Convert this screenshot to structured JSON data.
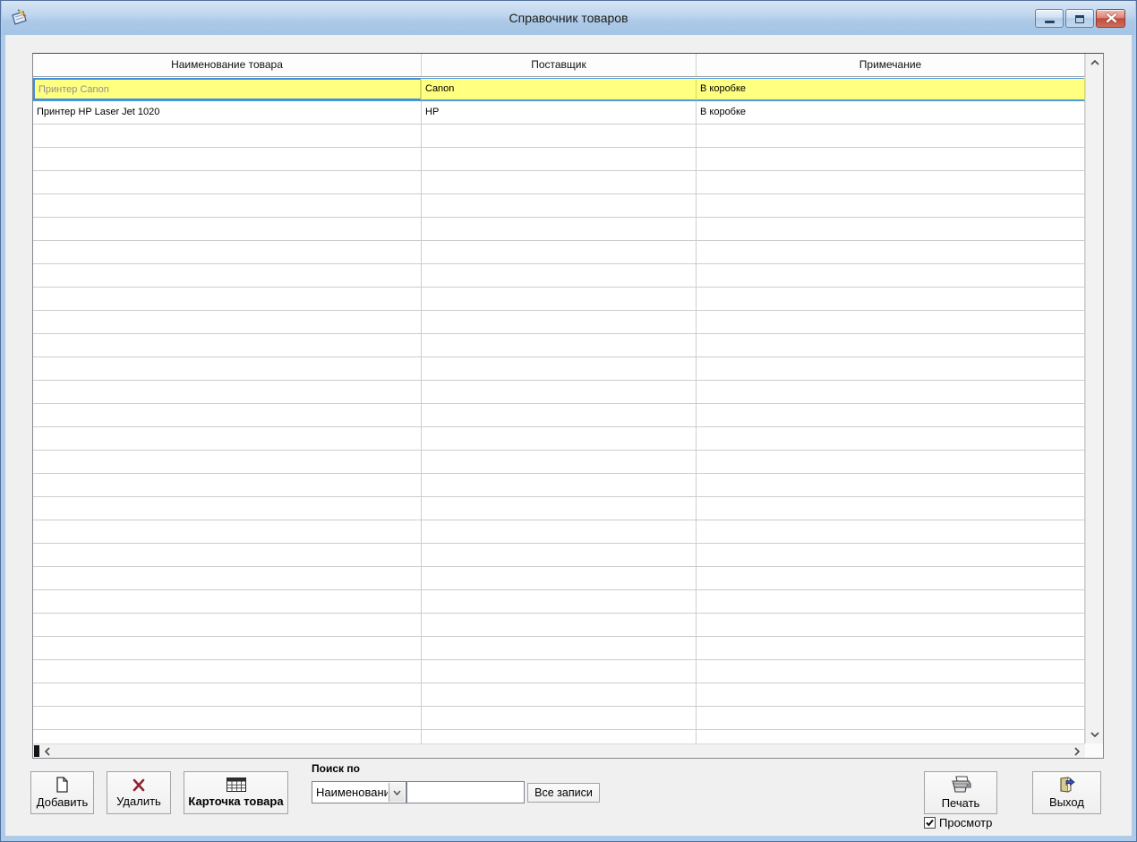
{
  "window": {
    "title": "Справочник товаров",
    "controls": [
      {
        "name": "minimize",
        "icon": "minimize-icon"
      },
      {
        "name": "maximize",
        "icon": "maximize-icon"
      },
      {
        "name": "close",
        "icon": "close-icon"
      }
    ],
    "app_icon": "notepad-pencil-icon"
  },
  "grid": {
    "columns": [
      {
        "label": "Наименование товара"
      },
      {
        "label": "Поставщик"
      },
      {
        "label": "Примечание"
      }
    ],
    "rows": [
      {
        "cells": [
          "Принтер Canon",
          "Canon",
          "В коробке"
        ],
        "selected": true
      },
      {
        "cells": [
          "Принтер HP Laser Jet 1020",
          "HP",
          "В коробке"
        ],
        "selected": false
      }
    ]
  },
  "actions": {
    "add": "Добавить",
    "delete": "Удалить",
    "card": "Карточка товара",
    "all_records": "Все записи",
    "print": "Печать",
    "preview": "Просмотр",
    "preview_checked": true,
    "exit": "Выход"
  },
  "search": {
    "label": "Поиск по",
    "field_selected": "Наименованию",
    "query": ""
  },
  "icons": {
    "add": "blank-document-icon",
    "delete": "red-cross-icon",
    "card": "spreadsheet-icon",
    "print": "printer-icon",
    "exit": "door-exit-icon",
    "combo_arrow": "chevron-down-icon",
    "preview": "checkmark-icon",
    "scrollbar": [
      "chevron-up-icon",
      "chevron-down-icon",
      "chevron-left-icon",
      "chevron-right-icon"
    ]
  },
  "colors": {
    "selection_yellow": "#FFFF80",
    "focus_blue": "#3E8FE0",
    "titlebar_blue": "#B9D2EC",
    "close_red": "#C14B3B",
    "client_gray": "#F0F0F0"
  }
}
